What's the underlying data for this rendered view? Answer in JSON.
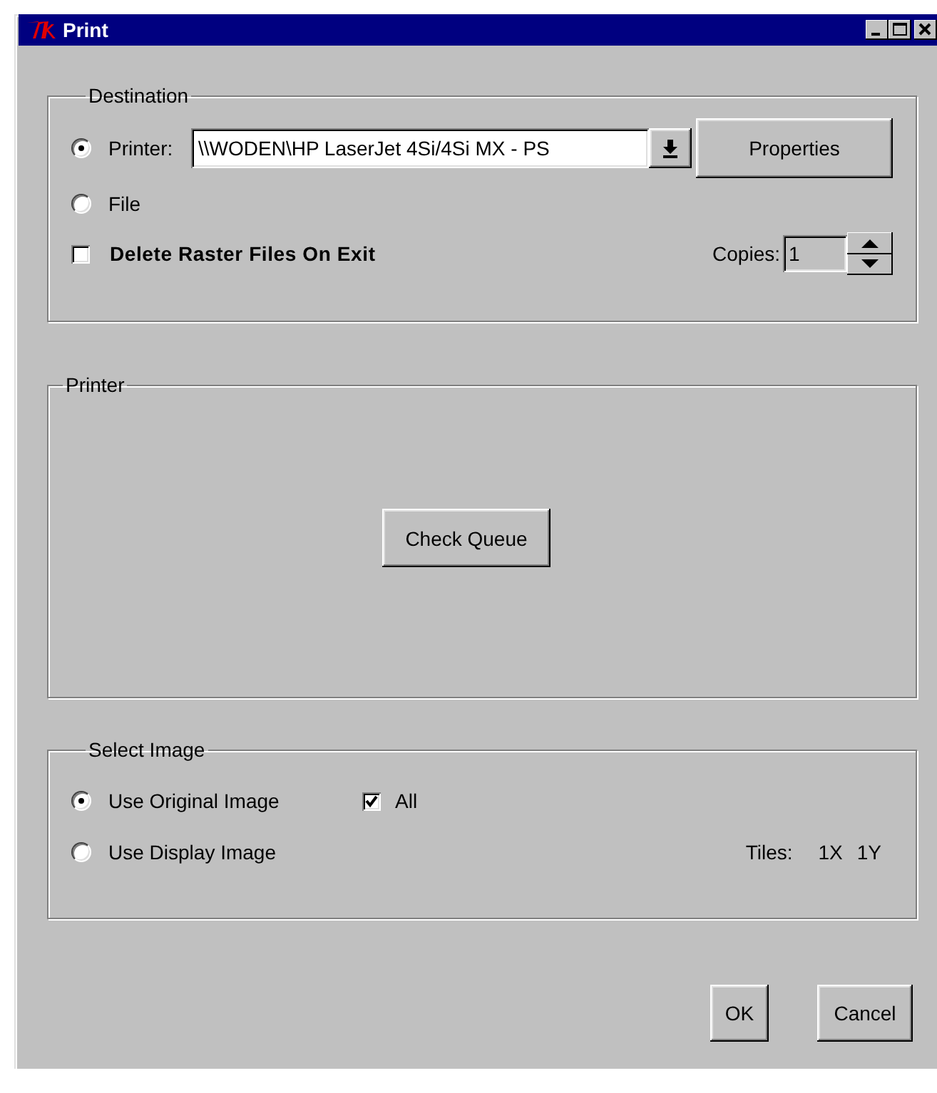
{
  "window": {
    "title": "Print"
  },
  "destination": {
    "title": "Destination",
    "options": [
      {
        "label": "Printer:",
        "selected": true
      },
      {
        "label": "File",
        "selected": false
      }
    ],
    "printer_field": {
      "value": "\\\\WODEN\\HP LaserJet 4Si/4Si MX - PS"
    },
    "properties_button": "Properties",
    "delete_raster": {
      "label": "Delete Raster Files On Exit",
      "checked": false
    },
    "copies": {
      "label": "Copies:",
      "value": "1"
    }
  },
  "printer": {
    "title": "Printer",
    "check_queue_button": "Check Queue"
  },
  "select_image": {
    "title": "Select Image",
    "options": [
      {
        "label": "Use Original Image",
        "selected": true
      },
      {
        "label": "Use Display Image",
        "selected": false
      }
    ],
    "all": {
      "label": "All",
      "checked": true
    },
    "tiles": {
      "label": "Tiles:",
      "x": "1X",
      "y": "1Y"
    }
  },
  "buttons": [
    "OK",
    "Cancel"
  ]
}
